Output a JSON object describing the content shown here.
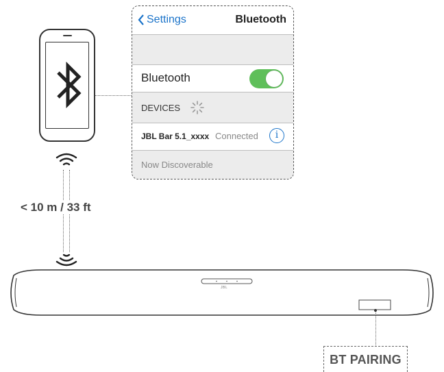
{
  "panel": {
    "back_label": "Settings",
    "title": "Bluetooth",
    "bluetooth_label": "Bluetooth",
    "bluetooth_on": true,
    "devices_label": "DEVICES",
    "device_name": "JBL Bar 5.1_xxxx",
    "device_status": "Connected",
    "info_glyph": "i",
    "discoverable_label": "Now Discoverable"
  },
  "distance_label": "< 10 m / 33 ft",
  "soundbar_logo": "JBL",
  "button_label": "BT PAIRING",
  "colors": {
    "accent_blue": "#1a73c9",
    "toggle_green": "#5fbf5a",
    "panel_gray": "#ececec"
  },
  "icons": [
    "bluetooth-icon",
    "chevron-left-icon",
    "spinner-icon",
    "info-icon",
    "wifi-signal-icon"
  ]
}
